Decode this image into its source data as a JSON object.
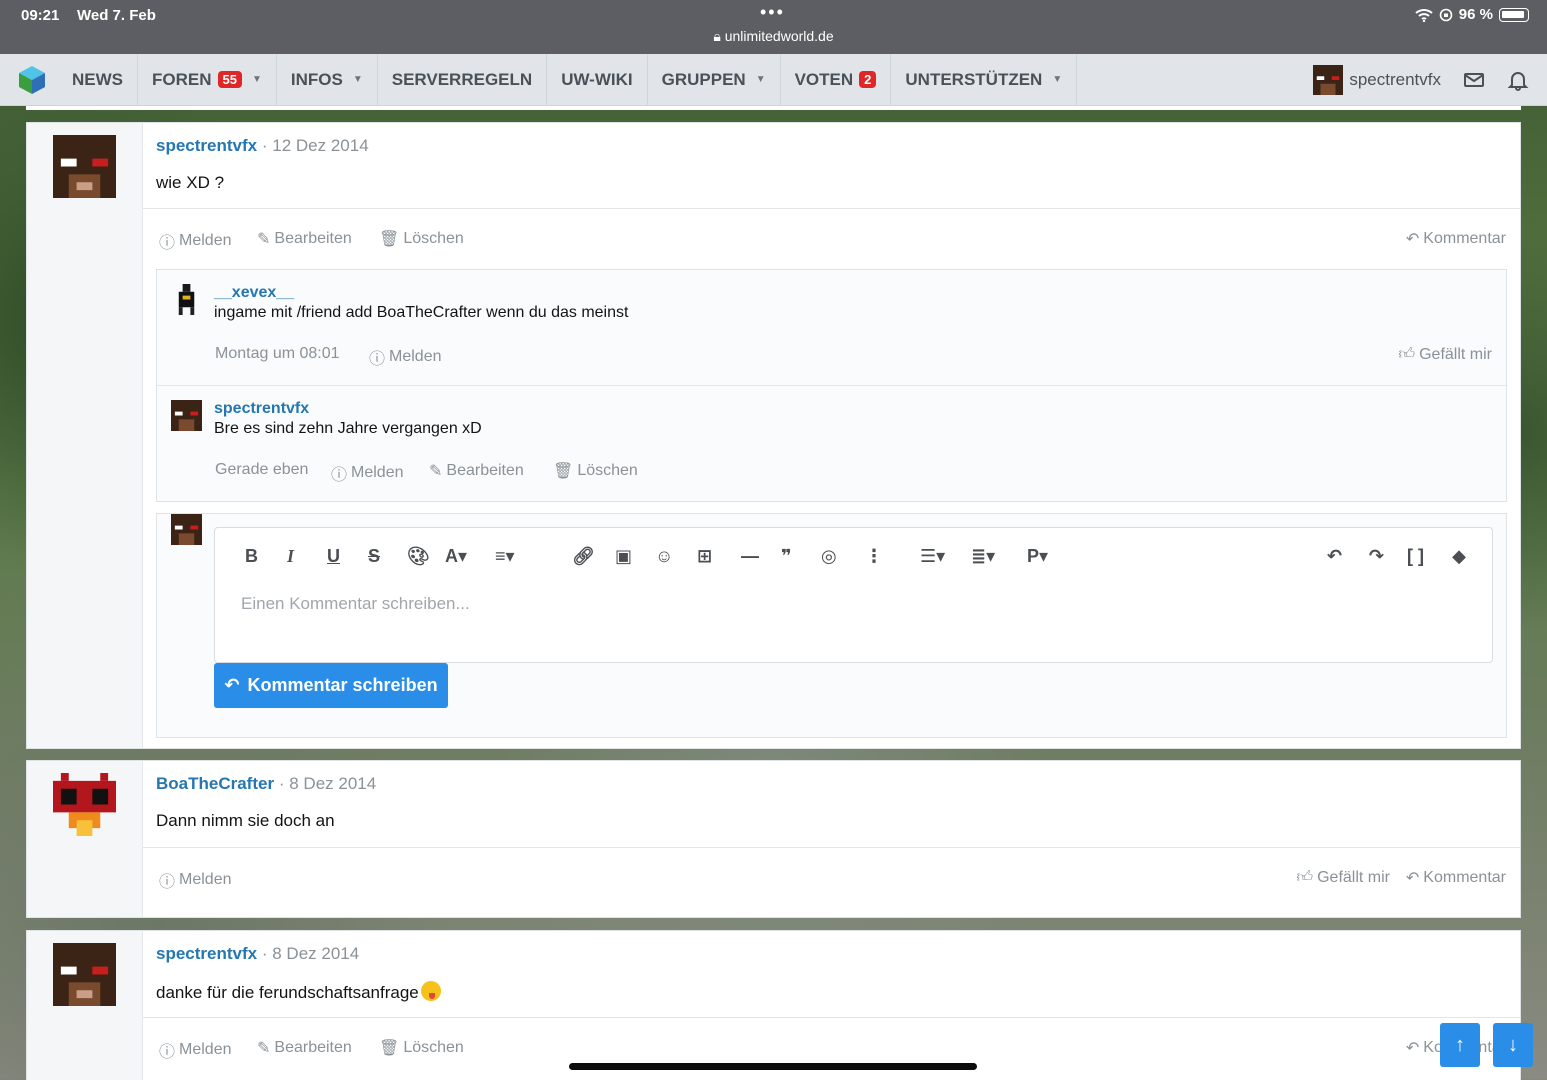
{
  "status": {
    "time": "09:21",
    "date": "Wed 7. Feb",
    "battery": "96 %",
    "url": "unlimitedworld.de"
  },
  "nav": {
    "items": [
      {
        "label": "NEWS",
        "badge": "",
        "caret": false
      },
      {
        "label": "FOREN",
        "badge": "55",
        "caret": true
      },
      {
        "label": "INFOS",
        "badge": "",
        "caret": true
      },
      {
        "label": "SERVERREGELN",
        "badge": "",
        "caret": false
      },
      {
        "label": "UW-WIKI",
        "badge": "",
        "caret": false
      },
      {
        "label": "GRUPPEN",
        "badge": "",
        "caret": true
      },
      {
        "label": "VOTEN",
        "badge": "2",
        "caret": false
      },
      {
        "label": "UNTERSTÜTZEN",
        "badge": "",
        "caret": true
      }
    ],
    "user": "spectrentvfx"
  },
  "labels": {
    "report": "Melden",
    "edit": "Bearbeiten",
    "delete": "Löschen",
    "comment": "Kommentar",
    "like": "Gefällt mir",
    "sep": "·"
  },
  "posts": [
    {
      "author": "spectrentvfx",
      "date": "12 Dez 2014",
      "text": "wie XD ?"
    },
    {
      "author": "BoaTheCrafter",
      "date": "8 Dez 2014",
      "text": "Dann nimm sie doch an"
    },
    {
      "author": "spectrentvfx",
      "date": "8 Dez 2014",
      "text": "danke für die ferundschaftsanfrage"
    }
  ],
  "comments": [
    {
      "author": "__xevex__",
      "text": "ingame mit /friend add BoaTheCrafter wenn du das meinst",
      "time": "Montag um 08:01"
    },
    {
      "author": "spectrentvfx",
      "text": "Bre es sind zehn Jahre vergangen xD",
      "time": "Gerade eben"
    }
  ],
  "editor": {
    "placeholder": "Einen Kommentar schreiben...",
    "submit": "Kommentar schreiben",
    "toolbar": [
      "B",
      "I",
      "U",
      "S",
      "P"
    ]
  },
  "colors": {
    "accent": "#2a8de7",
    "link": "#2577b1",
    "badge": "#e02727"
  }
}
